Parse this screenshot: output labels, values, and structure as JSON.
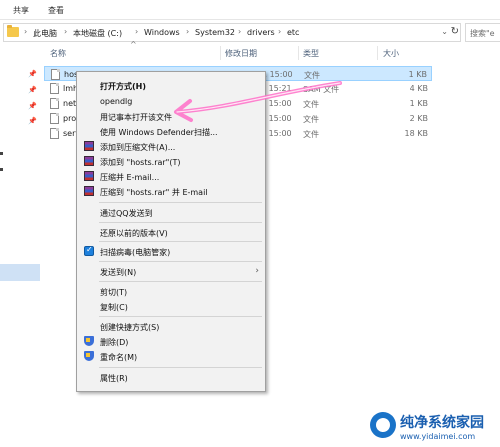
{
  "ribbon": {
    "tab_share": "共享",
    "tab_view": "查看"
  },
  "address": {
    "crumbs": [
      "此电脑",
      "本地磁盘 (C:)",
      "Windows",
      "System32",
      "drivers",
      "etc"
    ],
    "search_placeholder": "搜索\"e"
  },
  "columns": {
    "name": "名称",
    "date": "修改日期",
    "type": "类型",
    "size": "大小"
  },
  "files": [
    {
      "name": "hosts",
      "date": "2020/6/11 15:00",
      "type": "文件",
      "size": "1 KB"
    },
    {
      "name": "lmhosts.sam",
      "date": "2020/4/30 15:21",
      "type": "SAM 文件",
      "size": "4 KB"
    },
    {
      "name": "networks",
      "date": "2020/6/11 15:00",
      "type": "文件",
      "size": "1 KB"
    },
    {
      "name": "protocol",
      "date": "2020/6/11 15:00",
      "type": "文件",
      "size": "2 KB"
    },
    {
      "name": "services",
      "date": "2020/6/11 15:00",
      "type": "文件",
      "size": "18 KB"
    }
  ],
  "menu": {
    "open_with": "打开方式(H)",
    "opendlg": "opendlg",
    "open_notepad": "用记事本打开该文件",
    "defender": "使用 Windows Defender扫描...",
    "rar_add": "添加到压缩文件(A)...",
    "rar_add_hosts": "添加到 \"hosts.rar\"(T)",
    "rar_email": "压缩并 E-mail...",
    "rar_email_hosts": "压缩到 \"hosts.rar\" 并 E-mail",
    "qq_send": "通过QQ发送到",
    "restore": "还原以前的版本(V)",
    "scan_virus": "扫描病毒(电脑管家)",
    "send_to": "发送到(N)",
    "cut": "剪切(T)",
    "copy": "复制(C)",
    "shortcut": "创建快捷方式(S)",
    "delete": "删除(D)",
    "rename": "重命名(M)",
    "properties": "属性(R)"
  },
  "watermark": {
    "title": "纯净系统家园",
    "url": "www.yidaimei.com"
  },
  "colors": {
    "selection": "#cce8ff",
    "menu_bg": "#f2f2f2",
    "annotation": "#ff6fc8"
  },
  "icons": [
    "folder-icon",
    "file-icon",
    "pin-icon",
    "winrar-icon",
    "shield-icon",
    "qq-icon",
    "chevron-right-icon",
    "refresh-icon"
  ]
}
